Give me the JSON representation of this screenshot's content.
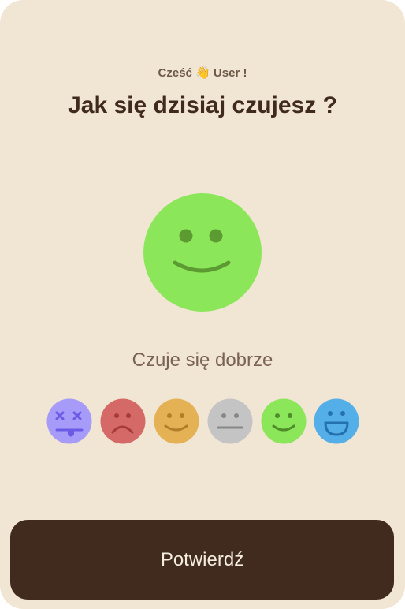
{
  "header": {
    "greeting_prefix": "Cześć",
    "greeting_emoji": "👋",
    "greeting_user": "User !",
    "question": "Jak się dzisiaj czujesz ?"
  },
  "selected_mood": {
    "label": "Czuje się dobrze",
    "icon": "smiling-face-icon",
    "color": "#8ce65a"
  },
  "mood_options": [
    {
      "icon": "dizzy-face-icon",
      "color": "#a79bfa"
    },
    {
      "icon": "sad-face-icon",
      "color": "#d56967"
    },
    {
      "icon": "content-face-icon",
      "color": "#e5b155"
    },
    {
      "icon": "neutral-face-icon",
      "color": "#c4c4c4"
    },
    {
      "icon": "smiling-face-icon",
      "color": "#8ce65a",
      "selected": true
    },
    {
      "icon": "grinning-face-icon",
      "color": "#54aee7"
    }
  ],
  "confirm_button": {
    "label": "Potwierdź",
    "color": "#412b1f"
  },
  "colors": {
    "background": "#f1e5d3",
    "heading": "#3f2a1d",
    "subtle_text": "#7a6352"
  }
}
